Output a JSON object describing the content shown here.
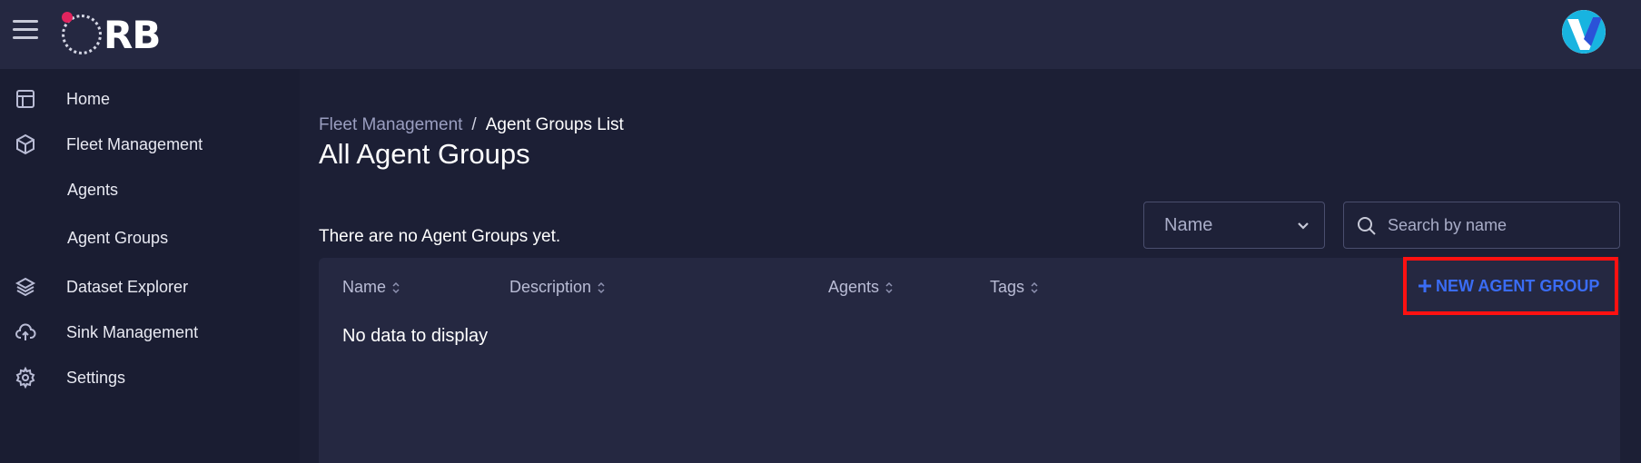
{
  "header": {
    "logo_text": "RB",
    "menu_icon": "hamburger-menu-icon",
    "avatar_icon": "user-avatar-icon"
  },
  "sidebar": {
    "items": [
      {
        "label": "Home",
        "icon": "layout-icon"
      },
      {
        "label": "Fleet Management",
        "icon": "cube-icon"
      },
      {
        "label": "Agents",
        "icon": ""
      },
      {
        "label": "Agent Groups",
        "icon": ""
      },
      {
        "label": "Dataset Explorer",
        "icon": "layers-icon"
      },
      {
        "label": "Sink Management",
        "icon": "cloud-upload-icon"
      },
      {
        "label": "Settings",
        "icon": "gear-icon"
      }
    ]
  },
  "main": {
    "breadcrumb": {
      "parent": "Fleet Management",
      "separator": "/",
      "current": "Agent Groups List"
    },
    "title": "All Agent Groups",
    "empty_note": "There are no Agent Groups yet.",
    "filter": {
      "selected": "Name",
      "icon": "chevron-down-icon"
    },
    "search": {
      "placeholder": "Search by name",
      "value": ""
    },
    "table": {
      "columns": [
        "Name",
        "Description",
        "Agents",
        "Tags"
      ],
      "rows": [],
      "empty_message": "No data to display"
    },
    "new_button": {
      "label": "NEW AGENT GROUP",
      "icon": "plus-icon"
    }
  },
  "colors": {
    "background": "#1c1f35",
    "header": "#252841",
    "sidebar": "#1a1d32",
    "panel": "#252841",
    "accent": "#3a6cf4",
    "highlight_frame": "#ff1111",
    "logo_dot": "#e0245e"
  }
}
